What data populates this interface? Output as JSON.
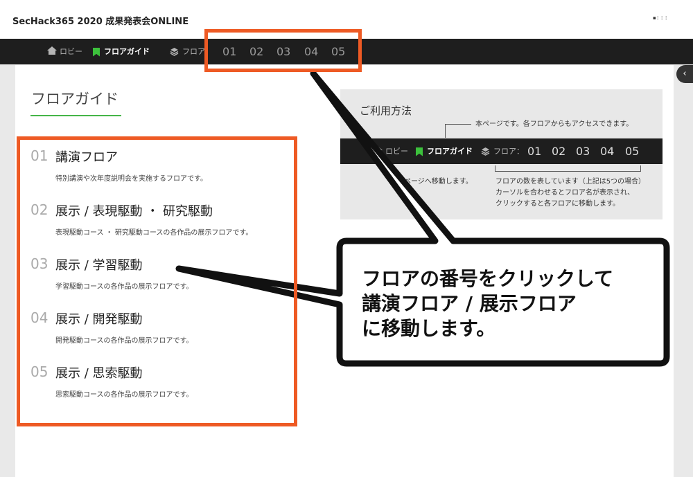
{
  "header": {
    "site_title": "SecHack365 2020 成果発表会ONLINE",
    "logo_text": "▪⋮⋮⋮"
  },
  "nav": {
    "lobby": "ロビー",
    "floor_guide": "フロアガイド",
    "floor_prefix": "フロア",
    "floor_numbers": [
      "01",
      "02",
      "03",
      "04",
      "05"
    ],
    "collapse_glyph": "‹"
  },
  "main": {
    "heading": "フロアガイド",
    "floors": [
      {
        "num": "01",
        "title": "講演フロア",
        "desc": "特別講演や次年度説明会を実施するフロアです。"
      },
      {
        "num": "02",
        "title": "展示 / 表現駆動 ・ 研究駆動",
        "desc": "表現駆動コース ・ 研究駆動コースの各作品の展示フロアです。"
      },
      {
        "num": "03",
        "title": "展示 / 学習駆動",
        "desc": "学習駆動コースの各作品の展示フロアです。"
      },
      {
        "num": "04",
        "title": "展示 / 開発駆動",
        "desc": "開発駆動コースの各作品の展示フロアです。"
      },
      {
        "num": "05",
        "title": "展示 / 思索駆動",
        "desc": "思索駆動コースの各作品の展示フロアです。"
      }
    ]
  },
  "howto": {
    "title": "ご利用方法",
    "note_top": "本ページです。各フロアからもアクセスできます。",
    "lobby": "ロビー",
    "floor_guide": "フロアガイド",
    "floor_prefix": "フロア：",
    "floor_numbers": [
      "01",
      "02",
      "03",
      "04",
      "05"
    ],
    "note_lobby": "ビーページへ移動します。",
    "note_floor_1": "フロアの数を表しています（上記は5つの場合）",
    "note_floor_2": "カーソルを合わせるとフロア名が表示され、",
    "note_floor_3": "クリックすると各フロアに移動します。"
  },
  "callout": {
    "line1": "フロアの番号をクリックして",
    "line2": "講演フロア / 展示フロア",
    "line3": "に移動します。"
  },
  "colors": {
    "accent_orange": "#ee5a24",
    "accent_green": "#3cc13c",
    "nav_bg": "#1e1e1e"
  }
}
